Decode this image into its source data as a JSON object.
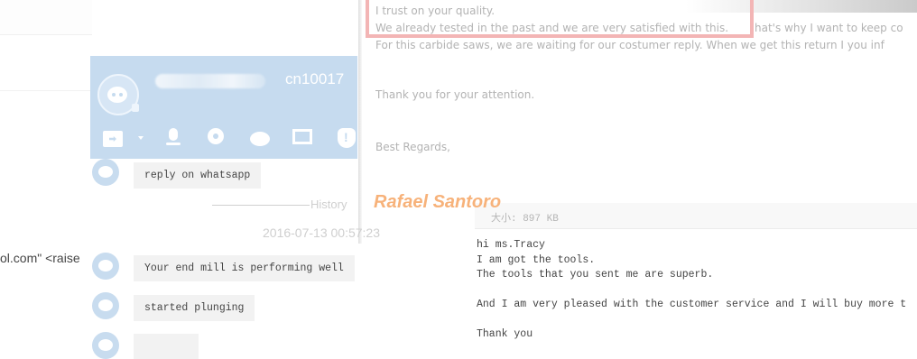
{
  "chat": {
    "contact_id": "cn10017",
    "history_label": "History",
    "time": "2016-07-13 00:57:23",
    "messages": [
      "reply on whatsapp",
      "Your end mill is performing well",
      "started plunging"
    ],
    "email_fragment": "ol.com\" <raise"
  },
  "email_top": {
    "lines": [
      "I trust on your quality.",
      "We already tested in the past and we are very satisfied with this.",
      "hat's why I want to keep co",
      "For this carbide saws, we are waiting for our costumer reply. When we get this return I you inf",
      "Thank you for your attention.",
      "Best Regards,"
    ],
    "signature": "Rafael Santoro"
  },
  "attachment": {
    "size_label": "大小: 897 KB"
  },
  "reply_email": {
    "lines": [
      "hi ms.Tracy",
      "I am got the tools.",
      "The tools that you sent me are superb.",
      "",
      "And I am very pleased with the customer service and I will buy more t",
      "",
      "Thank you"
    ]
  },
  "colors": {
    "chat_header": "#c6dbef",
    "highlight": "#f3b5b5",
    "signature": "#f7b27a"
  },
  "icons": [
    "file-transfer-icon",
    "dropdown-caret-icon",
    "microphone-icon",
    "video-camera-icon",
    "chat-bubble-icon",
    "screen-share-icon",
    "security-shield-icon"
  ]
}
